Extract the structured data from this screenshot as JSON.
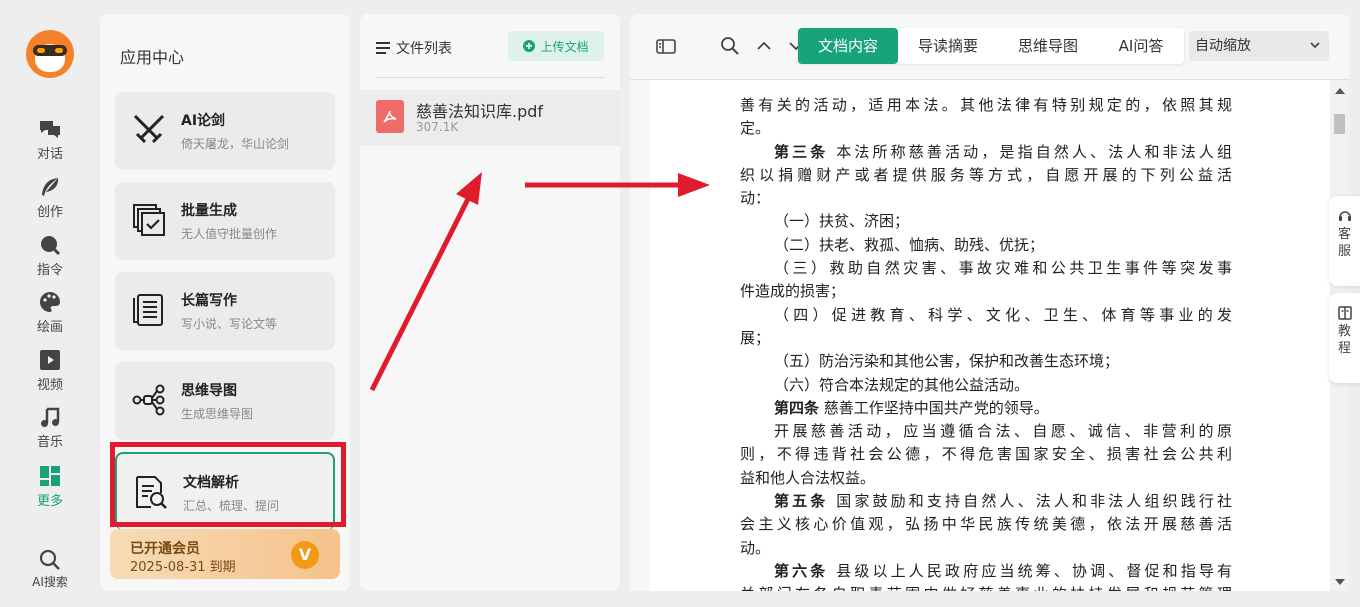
{
  "nav": {
    "items": [
      {
        "label": "对话",
        "icon": "chat-icon"
      },
      {
        "label": "创作",
        "icon": "feather-icon"
      },
      {
        "label": "指令",
        "icon": "command-icon"
      },
      {
        "label": "绘画",
        "icon": "palette-icon"
      },
      {
        "label": "视频",
        "icon": "video-icon"
      },
      {
        "label": "音乐",
        "icon": "music-icon"
      },
      {
        "label": "更多",
        "icon": "grid-icon"
      }
    ],
    "search_label": "AI搜索",
    "active_color": "#1aa17a"
  },
  "apps": {
    "title": "应用中心",
    "cards": [
      {
        "name": "AI论剑",
        "desc": "倚天屠龙，华山论剑",
        "icon": "crossed-swords-icon"
      },
      {
        "name": "批量生成",
        "desc": "无人值守批量创作",
        "icon": "batch-check-icon"
      },
      {
        "name": "长篇写作",
        "desc": "写小说、写论文等",
        "icon": "scroll-icon"
      },
      {
        "name": "思维导图",
        "desc": "生成思维导图",
        "icon": "mindmap-icon"
      },
      {
        "name": "文档解析",
        "desc": "汇总、梳理、提问",
        "icon": "doc-search-icon"
      }
    ],
    "vip": {
      "status": "已开通会员",
      "expiry": "2025-08-31 到期",
      "badge": "V"
    }
  },
  "files": {
    "title": "文件列表",
    "upload_label": "上传文档",
    "items": [
      {
        "name": "慈善法知识库.pdf",
        "size": "307.1K"
      }
    ]
  },
  "viewer": {
    "tabs": [
      "文档内容",
      "导读摘要",
      "思维导图",
      "AI问答"
    ],
    "active_tab": "文档内容",
    "zoom": "自动缩放",
    "accent_color": "#17a478",
    "lines": [
      {
        "text": "善有关的活动，适用本法。其他法律有特别规定的，依照其规",
        "indent": false,
        "just": true
      },
      {
        "text": "定。",
        "indent": false,
        "just": false
      },
      {
        "bold": "第三条",
        "text": " 本法所称慈善活动，是指自然人、法人和非法人组",
        "indent": true,
        "just": true
      },
      {
        "text": "织以捐赠财产或者提供服务等方式，自愿开展的下列公益活",
        "indent": false,
        "just": true
      },
      {
        "text": "动：",
        "indent": false,
        "just": false
      },
      {
        "text": "（一）扶贫、济困；",
        "indent": true,
        "just": false
      },
      {
        "text": "（二）扶老、救孤、恤病、助残、优抚；",
        "indent": true,
        "just": false
      },
      {
        "text": "（三）救助自然灾害、事故灾难和公共卫生事件等突发事",
        "indent": true,
        "just": true
      },
      {
        "text": "件造成的损害；",
        "indent": false,
        "just": false
      },
      {
        "text": "（四）促进教育、科学、文化、卫生、体育等事业的发",
        "indent": true,
        "just": true
      },
      {
        "text": "展；",
        "indent": false,
        "just": false
      },
      {
        "text": "（五）防治污染和其他公害，保护和改善生态环境；",
        "indent": true,
        "just": false
      },
      {
        "text": "（六）符合本法规定的其他公益活动。",
        "indent": true,
        "just": false
      },
      {
        "bold": "第四条",
        "text": " 慈善工作坚持中国共产党的领导。",
        "indent": true,
        "just": false
      },
      {
        "text": "开展慈善活动，应当遵循合法、自愿、诚信、非营利的原",
        "indent": true,
        "just": true
      },
      {
        "text": "则，不得违背社会公德，不得危害国家安全、损害社会公共利",
        "indent": false,
        "just": true
      },
      {
        "text": "益和他人合法权益。",
        "indent": false,
        "just": false
      },
      {
        "bold": "第五条",
        "text": " 国家鼓励和支持自然人、法人和非法人组织践行社",
        "indent": true,
        "just": true
      },
      {
        "text": "会主义核心价值观，弘扬中华民族传统美德，依法开展慈善活",
        "indent": false,
        "just": true
      },
      {
        "text": "动。",
        "indent": false,
        "just": false
      },
      {
        "bold": "第六条",
        "text": " 县级以上人民政府应当统筹、协调、督促和指导有",
        "indent": true,
        "just": true
      },
      {
        "text": "关部门在各自职责范围内做好慈善事业的扶持发展和规范管理",
        "indent": false,
        "just": true
      }
    ]
  },
  "side": {
    "service": "客服",
    "tutorial": "教程"
  }
}
